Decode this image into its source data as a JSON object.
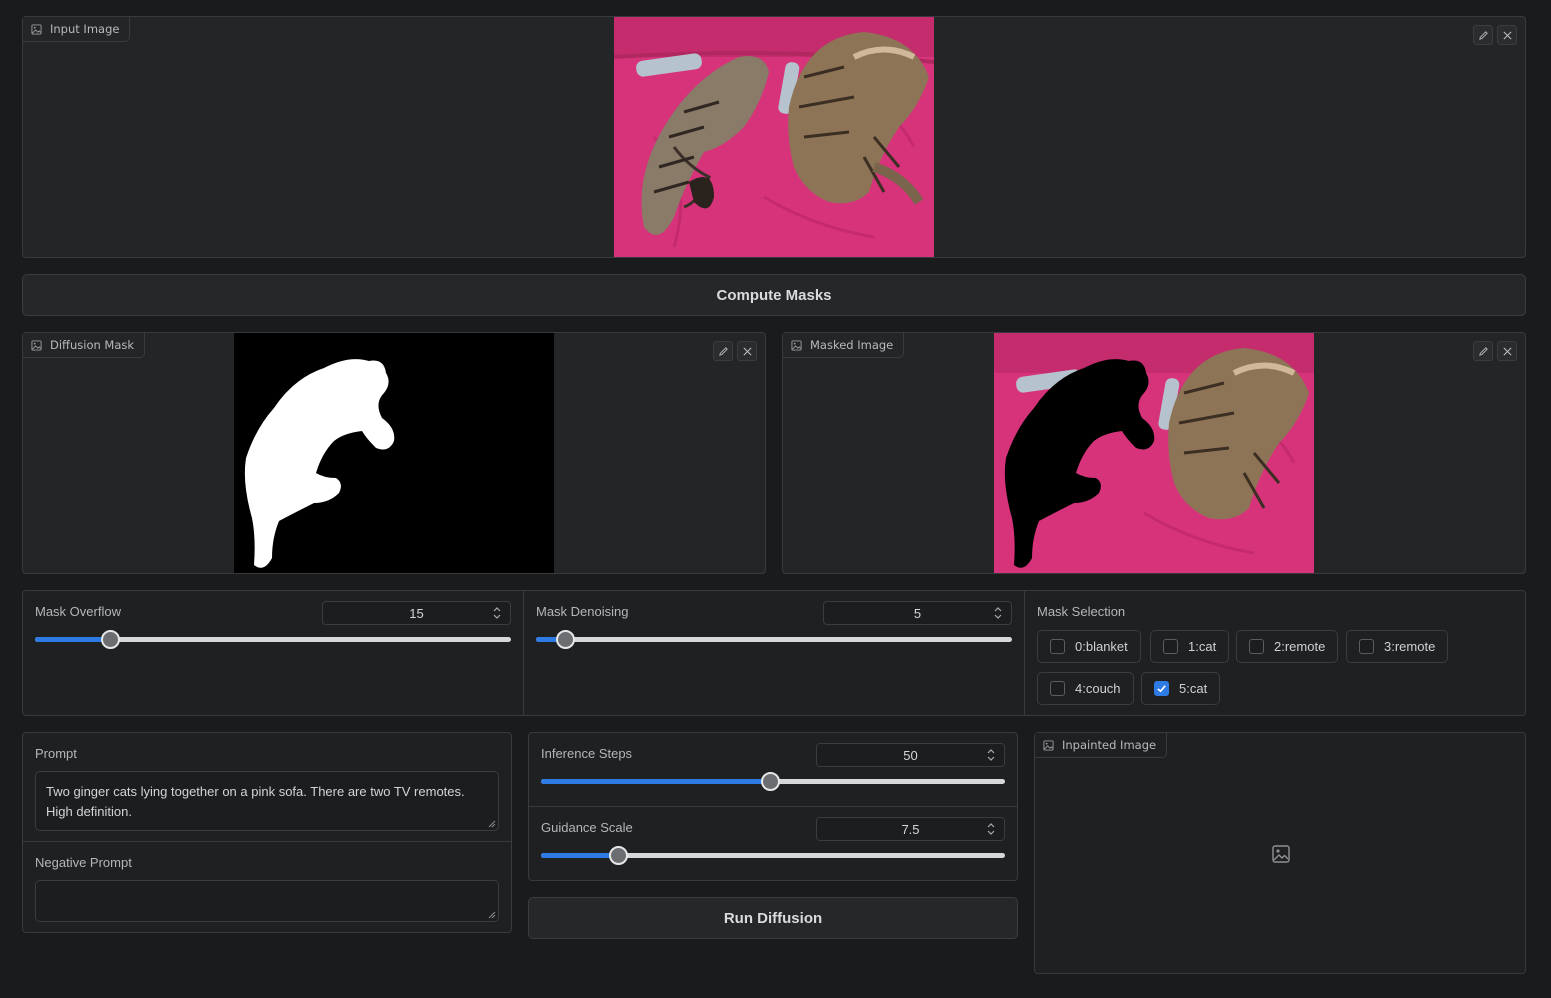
{
  "input_image": {
    "label": "Input Image"
  },
  "compute_masks": {
    "label": "Compute Masks"
  },
  "diffusion_mask": {
    "label": "Diffusion Mask"
  },
  "masked_image": {
    "label": "Masked Image"
  },
  "mask_overflow": {
    "label": "Mask Overflow",
    "value": "15",
    "fraction": 0.158
  },
  "mask_denoising": {
    "label": "Mask Denoising",
    "value": "5",
    "fraction": 0.061
  },
  "mask_selection": {
    "label": "Mask Selection",
    "options": [
      {
        "label": "0:blanket",
        "checked": false
      },
      {
        "label": "1:cat",
        "checked": false
      },
      {
        "label": "2:remote",
        "checked": false
      },
      {
        "label": "3:remote",
        "checked": false
      },
      {
        "label": "4:couch",
        "checked": false
      },
      {
        "label": "5:cat",
        "checked": true
      }
    ]
  },
  "prompt": {
    "label": "Prompt",
    "value": "Two ginger cats lying together on a pink sofa. There are two TV remotes. High definition."
  },
  "negative_prompt": {
    "label": "Negative Prompt",
    "value": ""
  },
  "inference_steps": {
    "label": "Inference Steps",
    "value": "50",
    "fraction": 0.494
  },
  "guidance_scale": {
    "label": "Guidance Scale",
    "value": "7.5",
    "fraction": 0.166
  },
  "run_diffusion": {
    "label": "Run Diffusion"
  },
  "inpainted_image": {
    "label": "Inpainted Image"
  }
}
